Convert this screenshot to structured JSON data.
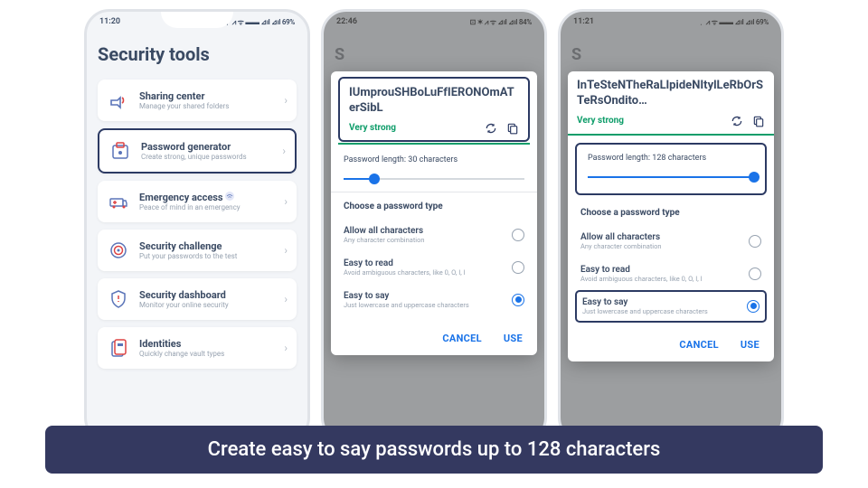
{
  "caption": "Create easy to say passwords up to 128 characters",
  "phone1": {
    "time": "11:20",
    "status_right": "✶ ⋮ ⩘ ᯤ ▬▬ ⊿ıl ⊿ıl 69%",
    "title": "Security tools",
    "tools": [
      {
        "title": "Sharing center",
        "sub": "Manage your shared folders"
      },
      {
        "title": "Password generator",
        "sub": "Create strong, unique passwords"
      },
      {
        "title": "Emergency access",
        "sub": "Peace of mind in an emergency"
      },
      {
        "title": "Security challenge",
        "sub": "Put your passwords to the test"
      },
      {
        "title": "Security dashboard",
        "sub": "Monitor your online security"
      },
      {
        "title": "Identities",
        "sub": "Quickly change vault types"
      }
    ]
  },
  "phone2": {
    "time": "22:46",
    "status_right": "⊡ ✶ ⩘ ᯤ ⊿ıl ⊿ıl 84%",
    "peek": "S",
    "password": "IUmprouSHBoLuFfIERONOmATerSibL",
    "strength": "Very strong",
    "length_label": "Password length: 30 characters",
    "slider_pct": 17,
    "section": "Choose a password type",
    "types": [
      {
        "title": "Allow all characters",
        "sub": "Any character combination",
        "on": false
      },
      {
        "title": "Easy to read",
        "sub": "Avoid ambiguous characters, like 0, O, I, l",
        "on": false
      },
      {
        "title": "Easy to say",
        "sub": "Just lowercase and uppercase characters",
        "on": true
      }
    ],
    "cancel": "CANCEL",
    "use": "USE"
  },
  "phone3": {
    "time": "11:21",
    "status_right": "✶ ⋮ ⩘ ᯤ ▬▬ ⊿ıl ⊿ıl 69%",
    "peek": "S",
    "password": "InTeSteNTheRaLlpideNItylLeRbOrSTeRsOndito…",
    "strength": "Very strong",
    "length_label": "Password length: 128 characters",
    "slider_pct": 100,
    "section": "Choose a password type",
    "types": [
      {
        "title": "Allow all characters",
        "sub": "Any character combination",
        "on": false
      },
      {
        "title": "Easy to read",
        "sub": "Avoid ambiguous characters, like 0, O, I, l",
        "on": false
      },
      {
        "title": "Easy to say",
        "sub": "Just lowercase and uppercase characters",
        "on": true
      }
    ],
    "cancel": "CANCEL",
    "use": "USE"
  }
}
